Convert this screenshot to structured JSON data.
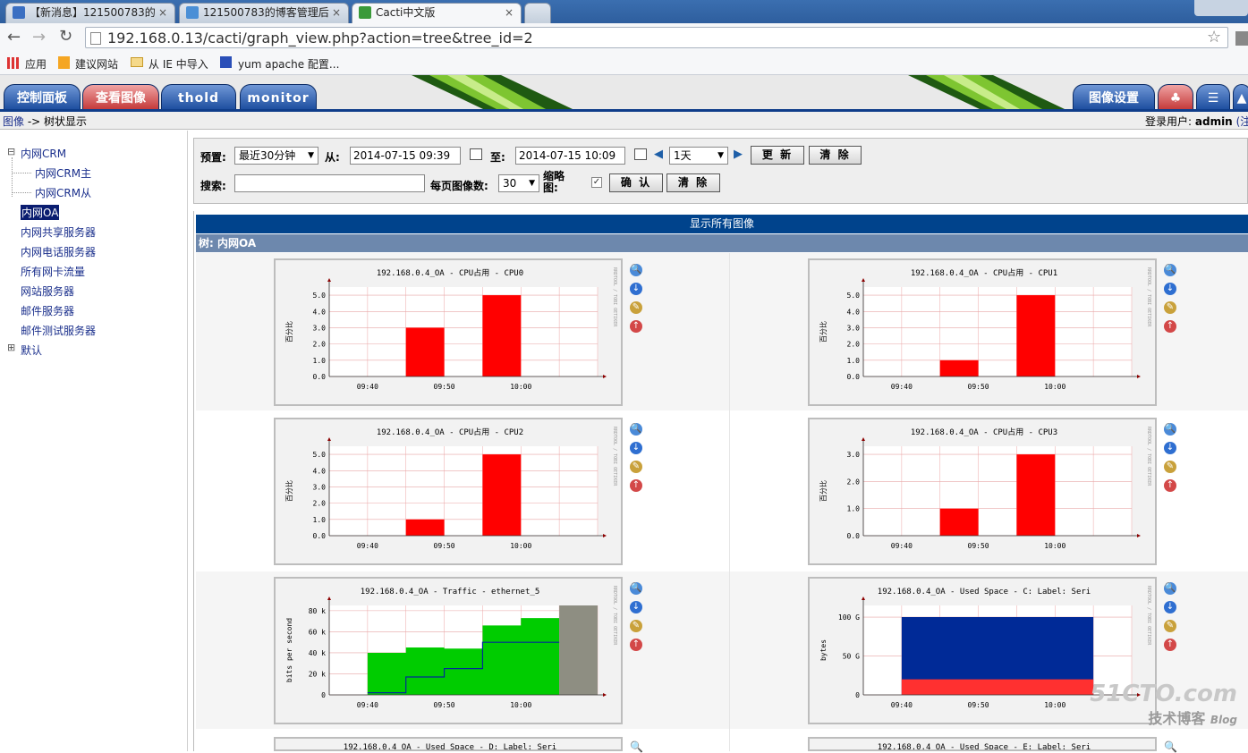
{
  "browser": {
    "tabs": [
      {
        "title": "【新消息】121500783的",
        "close": "×"
      },
      {
        "title": "121500783的博客管理后",
        "close": "×"
      },
      {
        "title": "Cacti中文版",
        "close": "×"
      }
    ],
    "url": "192.168.0.13/cacti/graph_view.php?action=tree&tree_id=2",
    "bookmarks": [
      "应用",
      "建议网站",
      "从 IE 中导入",
      "yum apache 配置..."
    ]
  },
  "cacti": {
    "tabs": [
      "控制面板",
      "查看图像",
      "thold",
      "monitor"
    ],
    "right_tab": "图像设置",
    "breadcrumb_link": "图像",
    "breadcrumb_rest": " -> 树状显示",
    "login_label": "登录用户:",
    "login_user": "admin",
    "login_suffix": "(注"
  },
  "tree": {
    "items": [
      {
        "label": "内网CRM",
        "toggle": "⊟"
      },
      {
        "label": "内网CRM主"
      },
      {
        "label": "内网CRM从"
      },
      {
        "label": "内网OA"
      },
      {
        "label": "内网共享服务器"
      },
      {
        "label": "内网电话服务器"
      },
      {
        "label": "所有网卡流量"
      },
      {
        "label": "网站服务器"
      },
      {
        "label": "邮件服务器"
      },
      {
        "label": "邮件测试服务器"
      },
      {
        "label": "默认",
        "toggle": "⊞"
      }
    ]
  },
  "filter": {
    "preset_label": "预置:",
    "preset_value": "最近30分钟",
    "from_label": "从:",
    "from_value": "2014-07-15 09:39",
    "to_label": "至:",
    "to_value": "2014-07-15 10:09",
    "span_value": "1天",
    "refresh_label": "更 新",
    "clear_label": "清 除",
    "search_label": "搜索:",
    "search_value": "",
    "per_page_label": "每页图像数:",
    "per_page_value": "30",
    "thumb_label": "缩略图:",
    "confirm_label": "确 认",
    "clear2_label": "清 除"
  },
  "graphs_header": "显示所有图像",
  "tree_path": "树: 内网OA",
  "side_text": "RRDTOOL / TOBI OETIKER",
  "watermark": {
    "line1": "51CTO.com",
    "line2": "技术博客",
    "line3": "Blog"
  },
  "chart_data": [
    {
      "type": "bar",
      "title": "192.168.0.4_OA - CPU占用 - CPU0",
      "ylabel": "百分比",
      "x_ticks": [
        "09:40",
        "09:50",
        "10:00"
      ],
      "y_ticks": [
        "0.0",
        "1.0",
        "2.0",
        "3.0",
        "4.0",
        "5.0"
      ],
      "ylim": [
        0,
        5.5
      ],
      "bars": [
        {
          "x_start": "09:45",
          "x_end": "09:50",
          "value": 3.0
        },
        {
          "x_start": "09:55",
          "x_end": "10:00",
          "value": 5.0
        }
      ],
      "color": "#ff0000"
    },
    {
      "type": "bar",
      "title": "192.168.0.4_OA - CPU占用 - CPU1",
      "ylabel": "百分比",
      "x_ticks": [
        "09:40",
        "09:50",
        "10:00"
      ],
      "y_ticks": [
        "0.0",
        "1.0",
        "2.0",
        "3.0",
        "4.0",
        "5.0"
      ],
      "ylim": [
        0,
        5.5
      ],
      "bars": [
        {
          "x_start": "09:45",
          "x_end": "09:50",
          "value": 1.0
        },
        {
          "x_start": "09:55",
          "x_end": "10:00",
          "value": 5.0
        }
      ],
      "color": "#ff0000"
    },
    {
      "type": "bar",
      "title": "192.168.0.4_OA - CPU占用 - CPU2",
      "ylabel": "百分比",
      "x_ticks": [
        "09:40",
        "09:50",
        "10:00"
      ],
      "y_ticks": [
        "0.0",
        "1.0",
        "2.0",
        "3.0",
        "4.0",
        "5.0"
      ],
      "ylim": [
        0,
        5.5
      ],
      "bars": [
        {
          "x_start": "09:45",
          "x_end": "09:50",
          "value": 1.0
        },
        {
          "x_start": "09:55",
          "x_end": "10:00",
          "value": 5.0
        }
      ],
      "color": "#ff0000"
    },
    {
      "type": "bar",
      "title": "192.168.0.4_OA - CPU占用 - CPU3",
      "ylabel": "百分比",
      "x_ticks": [
        "09:40",
        "09:50",
        "10:00"
      ],
      "y_ticks": [
        "0.0",
        "1.0",
        "2.0",
        "3.0"
      ],
      "ylim": [
        0,
        3.3
      ],
      "bars": [
        {
          "x_start": "09:45",
          "x_end": "09:50",
          "value": 1.0
        },
        {
          "x_start": "09:55",
          "x_end": "10:00",
          "value": 3.0
        }
      ],
      "color": "#ff0000"
    },
    {
      "type": "area",
      "title": "192.168.0.4_OA - Traffic - ethernet_5",
      "ylabel": "bits per second",
      "x_ticks": [
        "09:40",
        "09:50",
        "10:00"
      ],
      "y_ticks": [
        "0",
        "20 k",
        "40 k",
        "60 k",
        "80 k"
      ],
      "ylim": [
        0,
        85
      ],
      "series": [
        {
          "values": [
            {
              "x": "09:40",
              "y": 40
            },
            {
              "x": "09:45",
              "y": 45
            },
            {
              "x": "09:50",
              "y": 44
            },
            {
              "x": "09:55",
              "y": 66
            },
            {
              "x": "10:00",
              "y": 73
            }
          ],
          "color": "#00cc00"
        },
        {
          "values": [
            {
              "x": "09:40",
              "y": 2
            },
            {
              "x": "09:45",
              "y": 17
            },
            {
              "x": "09:50",
              "y": 25
            },
            {
              "x": "09:55",
              "y": 50
            },
            {
              "x": "10:00",
              "y": 50
            }
          ],
          "color": "#002a97"
        }
      ],
      "shaded_from": "10:05",
      "shaded_to": "10:10"
    },
    {
      "type": "area",
      "title": "192.168.0.4_OA - Used Space - C: Label: Seri",
      "ylabel": "bytes",
      "x_ticks": [
        "09:40",
        "09:50",
        "10:00"
      ],
      "y_ticks": [
        "0",
        "50 G",
        "100 G"
      ],
      "ylim": [
        0,
        115
      ],
      "series": [
        {
          "values": [
            {
              "x": "09:40",
              "y": 100
            },
            {
              "x": "10:05",
              "y": 100
            }
          ],
          "color": "#002a97"
        },
        {
          "values": [
            {
              "x": "09:40",
              "y": 20
            },
            {
              "x": "10:05",
              "y": 20
            }
          ],
          "color": "#ff3030"
        }
      ]
    }
  ],
  "partial_graphs": [
    "192.168.0.4_OA - Used Space - D: Label: Seri",
    "192.168.0.4_OA - Used Space - E: Label: Seri"
  ]
}
